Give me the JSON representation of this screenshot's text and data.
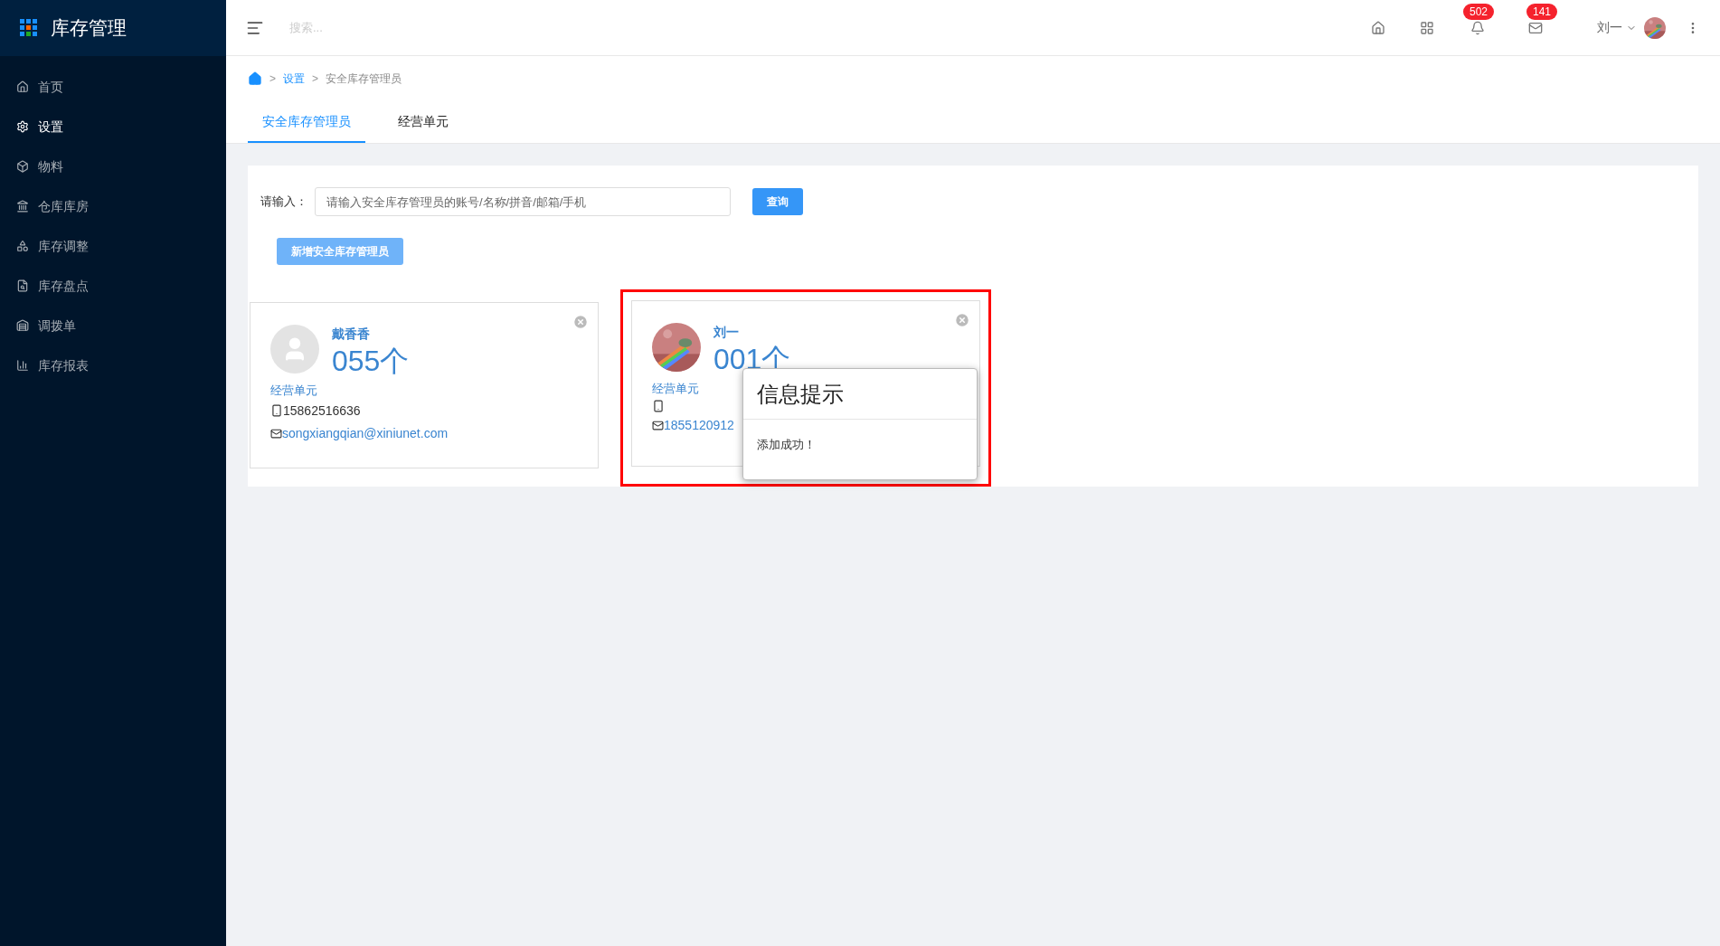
{
  "app": {
    "title": "库存管理"
  },
  "sidebar": {
    "items": [
      {
        "label": "首页",
        "selected": false
      },
      {
        "label": "设置",
        "selected": true
      },
      {
        "label": "物料",
        "selected": false
      },
      {
        "label": "仓库库房",
        "selected": false
      },
      {
        "label": "库存调整",
        "selected": false
      },
      {
        "label": "库存盘点",
        "selected": false
      },
      {
        "label": "调拨单",
        "selected": false
      },
      {
        "label": "库存报表",
        "selected": false
      }
    ]
  },
  "topbar": {
    "search_placeholder": "搜索...",
    "bell_badge": "502",
    "mail_badge": "141",
    "user": "刘一"
  },
  "breadcrumb": [
    {
      "separator": ">",
      "label": "设置"
    },
    {
      "separator": ">",
      "label": "安全库存管理员"
    }
  ],
  "tabs": [
    {
      "label": "安全库存管理员",
      "selected": true
    },
    {
      "label": "经营单元",
      "selected": false
    }
  ],
  "search": {
    "label": "请输入：",
    "placeholder": "请输入安全库存管理员的账号/名称/拼音/邮箱/手机",
    "button": "查询"
  },
  "add_button": "新增安全库存管理员",
  "cards": [
    {
      "name": "戴香香",
      "count": "055个",
      "unit": "经营单元",
      "phone": "15862516636",
      "email": "songxiangqian@xiniunet.com",
      "has_photo": false,
      "highlighted": false
    },
    {
      "name": "刘一",
      "count": "001个",
      "unit": "经营单元",
      "email": "1855120912",
      "has_photo": true,
      "highlighted": true
    }
  ],
  "dialog": {
    "title": "信息提示",
    "message": "添加成功！"
  }
}
